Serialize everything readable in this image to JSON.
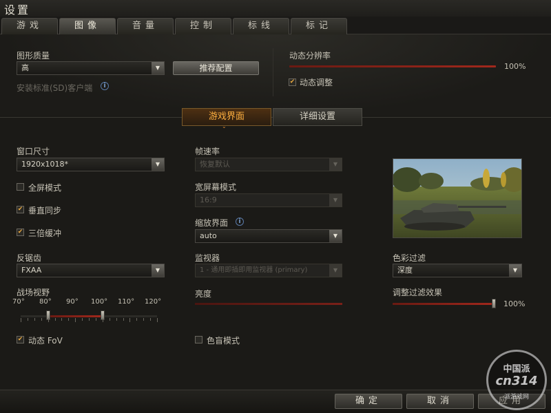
{
  "window": {
    "title": "设置"
  },
  "tabs": [
    {
      "label": "游戏",
      "active": false
    },
    {
      "label": "图像",
      "active": true
    },
    {
      "label": "音量",
      "active": false
    },
    {
      "label": "控制",
      "active": false
    },
    {
      "label": "标线",
      "active": false
    },
    {
      "label": "标记",
      "active": false
    }
  ],
  "graphics_quality": {
    "label": "图形质量",
    "value": "高",
    "recommend_button": "推荐配置",
    "install_sd_label": "安装标准(SD)客户端"
  },
  "dynamic_resolution": {
    "label": "动态分辨率",
    "value_text": "100%",
    "value": 1.0,
    "auto_adjust_label": "动态调整",
    "auto_adjust_checked": true
  },
  "subtabs": {
    "game_ui": "游戏界面",
    "advanced": "详细设置"
  },
  "left_col": {
    "window_size_label": "窗口尺寸",
    "window_size_value": "1920x1018*",
    "fullscreen_label": "全屏模式",
    "fullscreen_checked": false,
    "vsync_label": "垂直同步",
    "vsync_checked": true,
    "triple_buffer_label": "三倍缓冲",
    "triple_buffer_checked": true,
    "aa_label": "反锯齿",
    "aa_value": "FXAA",
    "fov_label": "战场视野",
    "fov_ticks": [
      "70°",
      "80°",
      "90°",
      "100°",
      "110°",
      "120°"
    ],
    "fov_min": 80,
    "fov_max": 100,
    "dynamic_fov_label": "动态 FoV",
    "dynamic_fov_checked": true
  },
  "mid_col": {
    "fps_label": "帧速率",
    "fps_value": "恢复默认",
    "widescreen_label": "宽屏幕模式",
    "widescreen_value": "16:9",
    "scale_label": "缩放界面",
    "scale_value": "auto",
    "monitor_label": "监视器",
    "monitor_value": "1 - 通用即插即用监视器 (primary)",
    "brightness_label": "亮度",
    "colorblind_label": "色盲模式",
    "colorblind_checked": false
  },
  "right_col": {
    "color_filter_label": "色彩过滤",
    "color_filter_value": "深度",
    "filter_effect_label": "调整过滤效果",
    "filter_effect_value_text": "100%",
    "filter_effect_value": 1.0
  },
  "footer": {
    "ok": "确定",
    "cancel": "取消",
    "apply": "应用"
  },
  "watermark": {
    "top": "中国派",
    "mid": "cn314",
    "bottom": "派游戏网"
  },
  "icons": {
    "info": "i",
    "check": "✔",
    "arrow": "▼"
  }
}
